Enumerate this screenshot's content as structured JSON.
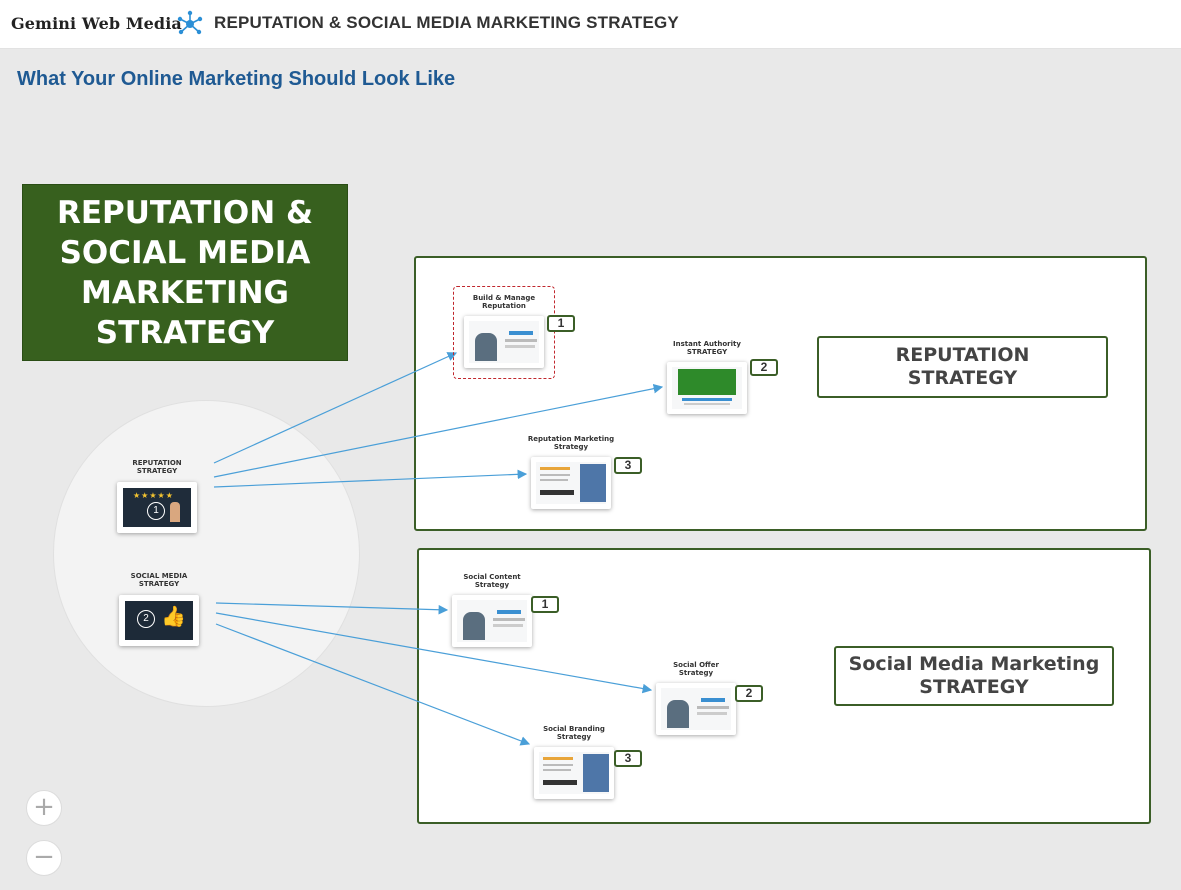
{
  "header": {
    "brand": "Gemini Web Media",
    "brand_icon": "network-nodes-icon",
    "title": "REPUTATION & SOCIAL MEDIA MARKETING STRATEGY"
  },
  "page_title": "What Your Online Marketing Should Look Like",
  "banner": "REPUTATION &\nSOCIAL MEDIA\nMARKETING\nSTRATEGY",
  "hub_nodes": {
    "reputation": {
      "caption": "REPUTATION\nSTRATEGY",
      "number": "1"
    },
    "social": {
      "caption": "SOCIAL MEDIA\nSTRATEGY",
      "number": "2"
    }
  },
  "reputation_panel": {
    "label": "REPUTATION\nSTRATEGY",
    "items": [
      {
        "caption": "Build & Manage\nReputation",
        "number": "1"
      },
      {
        "caption": "Instant Authority\nSTRATEGY",
        "number": "2"
      },
      {
        "caption": "Reputation Marketing\nStrategy",
        "number": "3"
      }
    ]
  },
  "social_panel": {
    "label": "Social Media Marketing\nSTRATEGY",
    "items": [
      {
        "caption": "Social Content\nStrategy",
        "number": "1"
      },
      {
        "caption": "Social Offer\nStrategy",
        "number": "2"
      },
      {
        "caption": "Social Branding\nStrategy",
        "number": "3"
      }
    ]
  },
  "zoom": {
    "in": "+",
    "out": "−"
  },
  "colors": {
    "accent_green": "#37601e",
    "link_blue": "#4a9fd8",
    "title_blue": "#1f5a93",
    "highlight_red": "#c0272d"
  }
}
